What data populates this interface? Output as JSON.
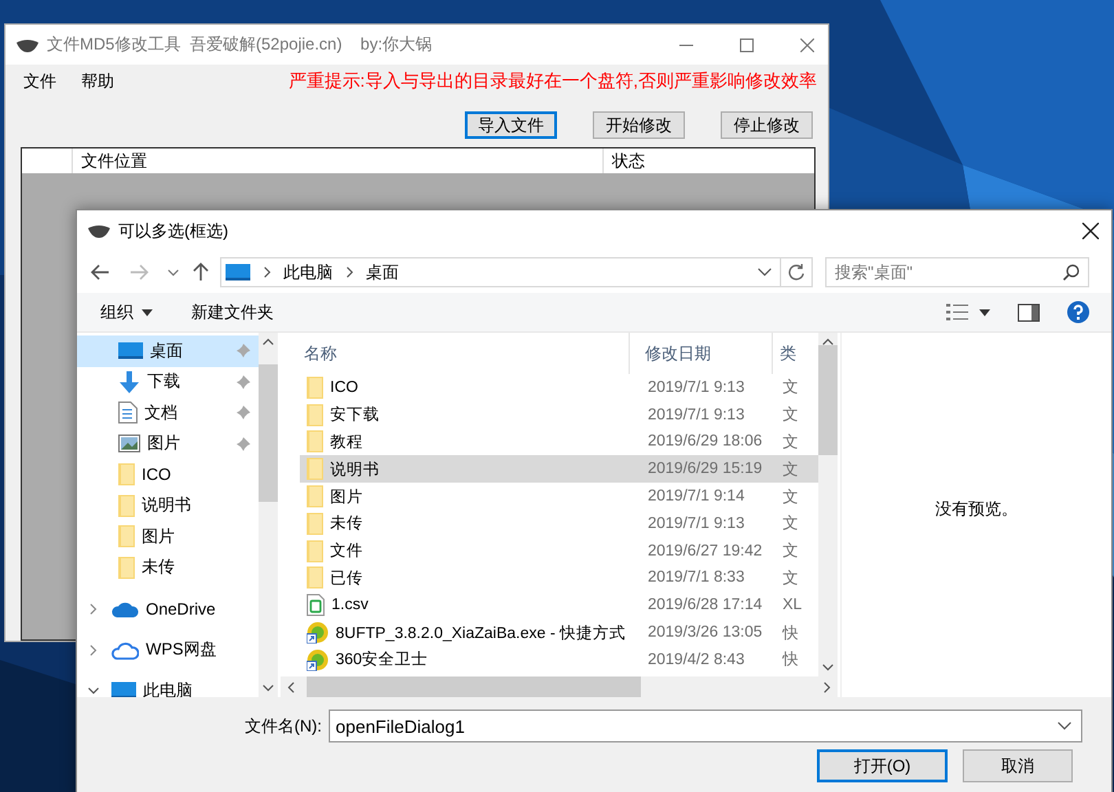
{
  "main_window": {
    "title": "文件MD5修改工具  吾爱破解(52pojie.cn)    by:你大锅",
    "menu": [
      {
        "label": "文件"
      },
      {
        "label": "帮助"
      }
    ],
    "warning": "严重提示:导入与导出的目录最好在一个盘符,否则严重影响修改效率",
    "buttons": [
      {
        "label": "导入文件",
        "focused": true
      },
      {
        "label": "开始修改",
        "focused": false
      },
      {
        "label": "停止修改",
        "focused": false
      }
    ],
    "list": {
      "columns": [
        "文件位置",
        "状态"
      ]
    }
  },
  "dialog": {
    "title": "可以多选(框选)",
    "breadcrumb": [
      "此电脑",
      "桌面"
    ],
    "search": {
      "placeholder": "搜索\"桌面\""
    },
    "toolbar": [
      {
        "label": "组织",
        "dropdown": true
      },
      {
        "label": "新建文件夹",
        "dropdown": false
      }
    ],
    "nav": [
      {
        "label": "桌面",
        "kind": "desktop",
        "pinned": true,
        "selected": true
      },
      {
        "label": "下载",
        "kind": "download",
        "pinned": true,
        "selected": false
      },
      {
        "label": "文档",
        "kind": "document",
        "pinned": true,
        "selected": false
      },
      {
        "label": "图片",
        "kind": "pictures",
        "pinned": true,
        "selected": false
      },
      {
        "label": "ICO",
        "kind": "folder",
        "pinned": false,
        "selected": false
      },
      {
        "label": "说明书",
        "kind": "folder",
        "pinned": false,
        "selected": false
      },
      {
        "label": "图片",
        "kind": "folder",
        "pinned": false,
        "selected": false
      },
      {
        "label": "未传",
        "kind": "folder",
        "pinned": false,
        "selected": false
      },
      {
        "label": "OneDrive",
        "kind": "onedrive",
        "expanded": false,
        "selected": false
      },
      {
        "label": "WPS网盘",
        "kind": "cloud",
        "expanded": false,
        "selected": false
      },
      {
        "label": "此电脑",
        "kind": "pc",
        "expanded": true,
        "selected": false
      }
    ],
    "columns": [
      "名称",
      "修改日期",
      "类"
    ],
    "files": [
      {
        "name": "ICO",
        "date": "2019/7/1 9:13",
        "type": "文",
        "kind": "folder",
        "selected": false
      },
      {
        "name": "安下载",
        "date": "2019/7/1 9:13",
        "type": "文",
        "kind": "folder",
        "selected": false
      },
      {
        "name": "教程",
        "date": "2019/6/29 18:06",
        "type": "文",
        "kind": "folder",
        "selected": false
      },
      {
        "name": "说明书",
        "date": "2019/6/29 15:19",
        "type": "文",
        "kind": "folder",
        "selected": true
      },
      {
        "name": "图片",
        "date": "2019/7/1 9:14",
        "type": "文",
        "kind": "folder",
        "selected": false
      },
      {
        "name": "未传",
        "date": "2019/7/1 9:13",
        "type": "文",
        "kind": "folder",
        "selected": false
      },
      {
        "name": "文件",
        "date": "2019/6/27 19:42",
        "type": "文",
        "kind": "folder",
        "selected": false
      },
      {
        "name": "已传",
        "date": "2019/7/1 8:33",
        "type": "文",
        "kind": "folder",
        "selected": false
      },
      {
        "name": "1.csv",
        "date": "2019/6/28 17:14",
        "type": "XL",
        "kind": "sheet",
        "selected": false
      },
      {
        "name": "8UFTP_3.8.2.0_XiaZaiBa.exe - 快捷方式",
        "date": "2019/3/26 13:05",
        "type": "快",
        "kind": "shortcut",
        "selected": false
      },
      {
        "name": "360安全卫士",
        "date": "2019/4/2 8:43",
        "type": "快",
        "kind": "shortcut",
        "selected": false
      }
    ],
    "preview": "没有预览。",
    "filename": {
      "label": "文件名(N):",
      "value": "openFileDialog1"
    },
    "buttons": [
      {
        "label": "打开(O)",
        "default": true
      },
      {
        "label": "取消",
        "default": false
      }
    ]
  }
}
